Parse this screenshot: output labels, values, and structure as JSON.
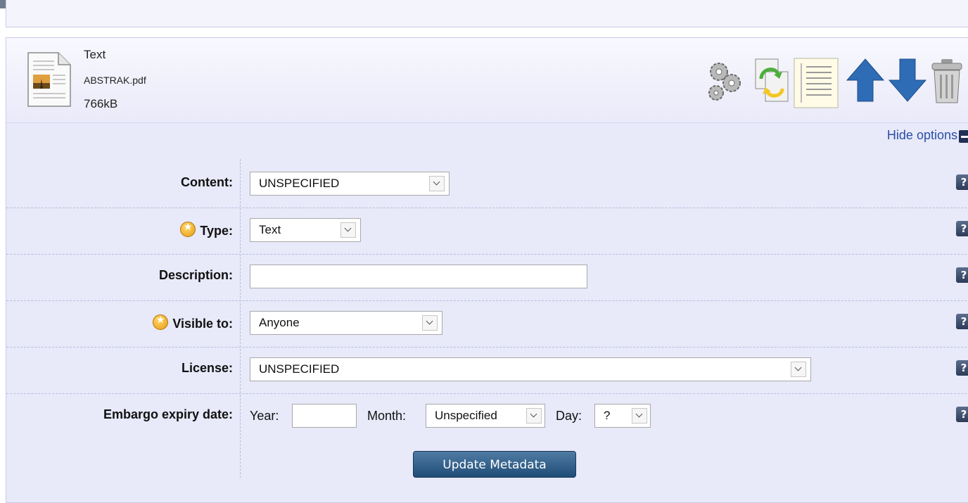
{
  "file": {
    "type_label": "Text",
    "filename": "ABSTRAK.pdf",
    "size": "766kB"
  },
  "toolbar": {
    "icons": [
      "gears-icon",
      "replace-file-icon",
      "details-page-icon",
      "move-up-icon",
      "move-down-icon",
      "trash-icon"
    ]
  },
  "options": {
    "hide_label": "Hide options"
  },
  "form": {
    "content": {
      "label": "Content:",
      "value": "UNSPECIFIED"
    },
    "type": {
      "label": "Type:",
      "value": "Text"
    },
    "description": {
      "label": "Description:",
      "value": ""
    },
    "visible": {
      "label": "Visible to:",
      "value": "Anyone"
    },
    "license": {
      "label": "License:",
      "value": "UNSPECIFIED"
    },
    "embargo": {
      "label": "Embargo expiry date:",
      "year_label": "Year:",
      "year_value": "",
      "month_label": "Month:",
      "month_value": "Unspecified",
      "day_label": "Day:",
      "day_value": "?"
    },
    "help_text": "?",
    "submit_label": "Update Metadata"
  },
  "colors": {
    "panel_bg": "#e8e9f9",
    "link": "#2a4ea8",
    "button": "#1f4d78",
    "arrow": "#2e6cb5"
  }
}
